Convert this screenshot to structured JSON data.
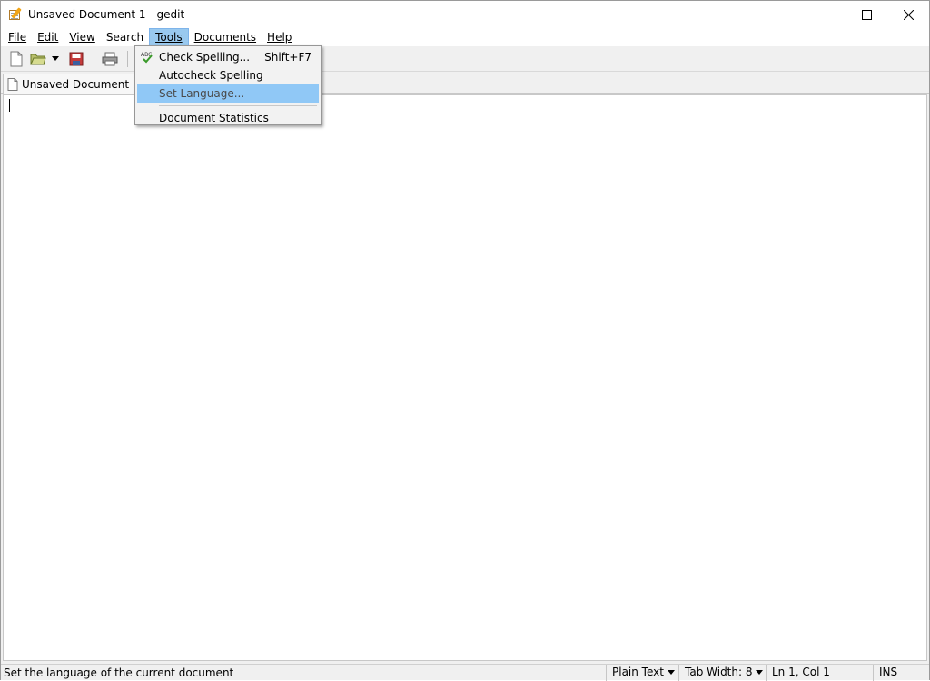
{
  "window": {
    "title": "Unsaved Document 1 - gedit"
  },
  "menubar": {
    "items": [
      {
        "label": "File"
      },
      {
        "label": "Edit"
      },
      {
        "label": "View"
      },
      {
        "label": "Search"
      },
      {
        "label": "Tools"
      },
      {
        "label": "Documents"
      },
      {
        "label": "Help"
      }
    ]
  },
  "tab": {
    "label": "Unsaved Document 1"
  },
  "tools_menu": {
    "items": [
      {
        "label": "Check Spelling...",
        "shortcut": "Shift+F7"
      },
      {
        "label": "Autocheck Spelling"
      },
      {
        "label": "Set Language..."
      },
      {
        "label": "Document Statistics"
      }
    ]
  },
  "statusbar": {
    "message": "Set the language of the current document",
    "language": "Plain Text",
    "tab_width": "Tab Width:  8",
    "position": "Ln 1, Col 1",
    "mode": "INS"
  },
  "colors": {
    "menu_highlight": "#90c8f6",
    "menu_active": "#99c9ef"
  }
}
